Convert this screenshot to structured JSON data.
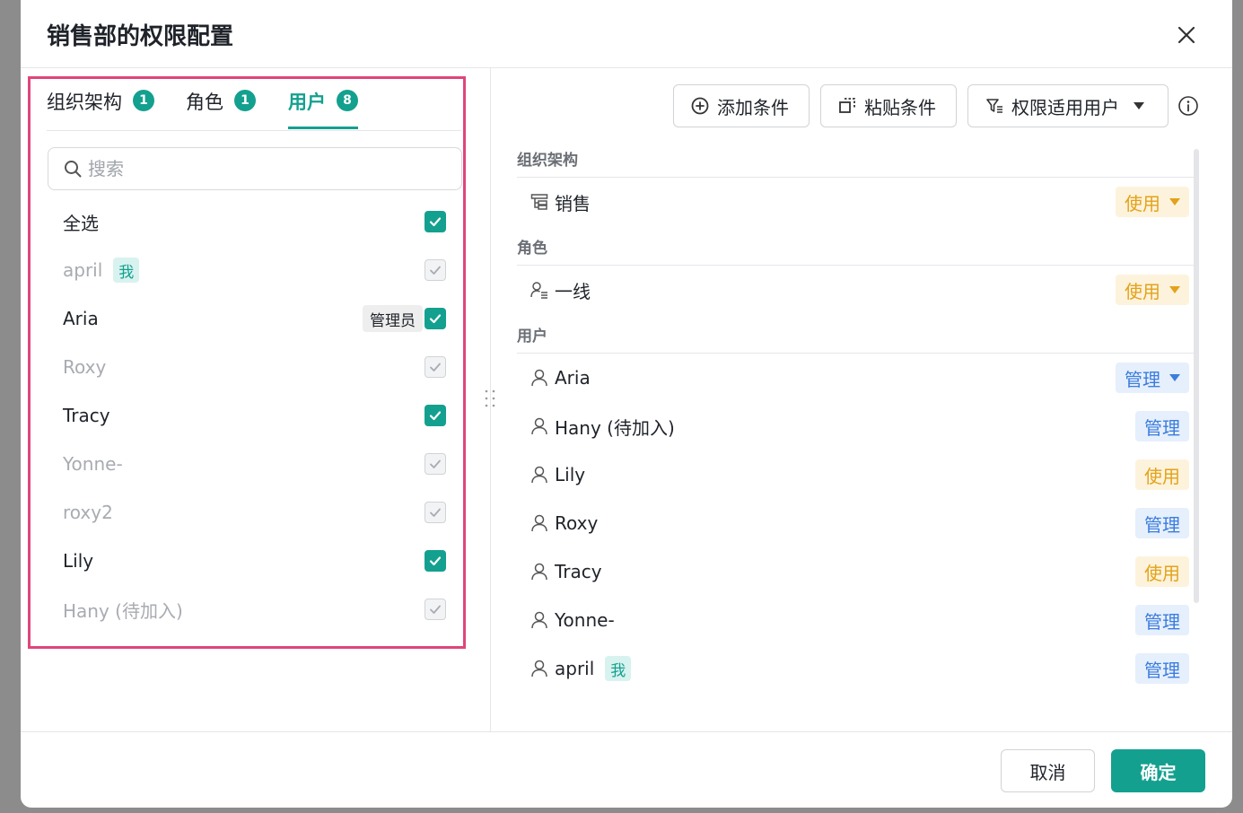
{
  "dialog": {
    "title": "销售部的权限配置"
  },
  "tabs": [
    {
      "label": "组织架构",
      "count": "1"
    },
    {
      "label": "角色",
      "count": "1"
    },
    {
      "label": "用户",
      "count": "8"
    }
  ],
  "search": {
    "placeholder": "搜索",
    "value": ""
  },
  "select_all": {
    "label": "全选",
    "checked": true
  },
  "users": [
    {
      "name": "april",
      "me_tag": "我",
      "checked": true,
      "disabled": true
    },
    {
      "name": "Aria",
      "admin_tag": "管理员",
      "checked": true,
      "disabled": false
    },
    {
      "name": "Roxy",
      "checked": true,
      "disabled": true
    },
    {
      "name": "Tracy",
      "checked": true,
      "disabled": false
    },
    {
      "name": "Yonne-",
      "checked": true,
      "disabled": true
    },
    {
      "name": "roxy2",
      "checked": true,
      "disabled": true
    },
    {
      "name": "Lily",
      "checked": true,
      "disabled": false
    },
    {
      "name": "Hany (待加入)",
      "checked": true,
      "disabled": true
    }
  ],
  "toolbar": {
    "add_condition": "添加条件",
    "paste_condition": "粘贴条件",
    "applicable_users": "权限适用用户"
  },
  "sections": {
    "org": {
      "title": "组织架构",
      "items": [
        {
          "name": "销售",
          "perm": "使用",
          "dropdown": true
        }
      ]
    },
    "role": {
      "title": "角色",
      "items": [
        {
          "name": "一线",
          "perm": "使用",
          "dropdown": true
        }
      ]
    },
    "user": {
      "title": "用户",
      "items": [
        {
          "name": "Aria",
          "perm": "管理",
          "dropdown": true
        },
        {
          "name": "Hany (待加入)",
          "perm": "管理"
        },
        {
          "name": "Lily",
          "perm": "使用"
        },
        {
          "name": "Roxy",
          "perm": "管理"
        },
        {
          "name": "Tracy",
          "perm": "使用"
        },
        {
          "name": "Yonne-",
          "perm": "管理"
        },
        {
          "name": "april",
          "me_tag": "我",
          "perm": "管理"
        }
      ]
    }
  },
  "footer": {
    "cancel": "取消",
    "confirm": "确定"
  },
  "colors": {
    "accent": "#14a08f",
    "use_tag": "#e3a21a",
    "manage_tag": "#3b7ddd",
    "highlight_border": "#e0457b"
  }
}
